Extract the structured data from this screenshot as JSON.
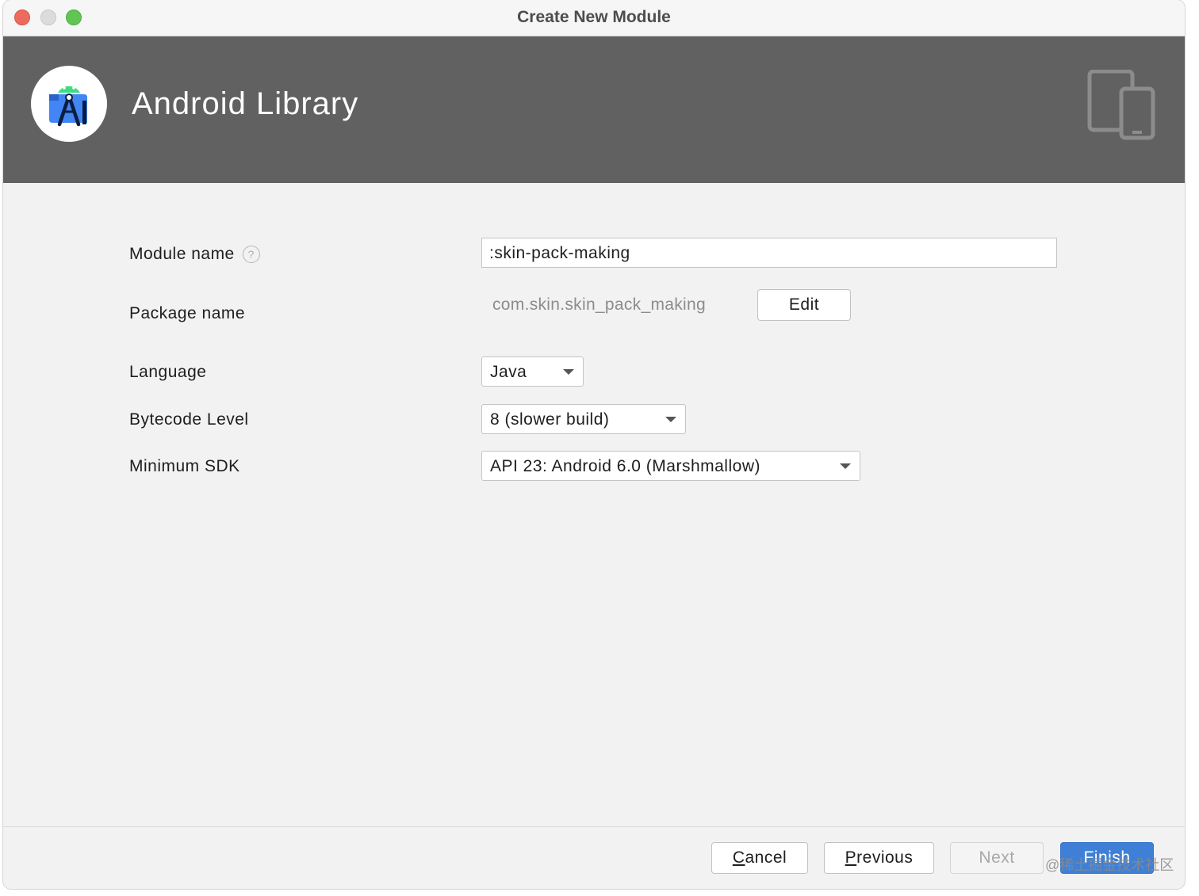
{
  "window": {
    "title": "Create New Module",
    "controls": [
      "close",
      "minimize",
      "zoom"
    ]
  },
  "header": {
    "title": "Android Library",
    "logo_icon": "android-studio-icon",
    "device_icon": "devices-icon",
    "background_color": "#616161"
  },
  "form": {
    "module_name": {
      "label": "Module name",
      "help_icon": "question-mark",
      "value": ":skin-pack-making"
    },
    "package_name": {
      "label": "Package name",
      "value": "com.skin.skin_pack_making",
      "edit_label": "Edit"
    },
    "language": {
      "label": "Language",
      "selected": "Java"
    },
    "bytecode_level": {
      "label": "Bytecode Level",
      "selected": "8 (slower build)"
    },
    "minimum_sdk": {
      "label": "Minimum SDK",
      "selected": "API 23: Android 6.0 (Marshmallow)"
    }
  },
  "footer": {
    "cancel": {
      "mnemonic": "C",
      "rest": "ancel"
    },
    "previous": {
      "mnemonic": "P",
      "rest": "revious"
    },
    "next": "Next",
    "finish": "Finish",
    "primary_color": "#3f80d6"
  },
  "watermark": "@稀土掘金技术社区"
}
